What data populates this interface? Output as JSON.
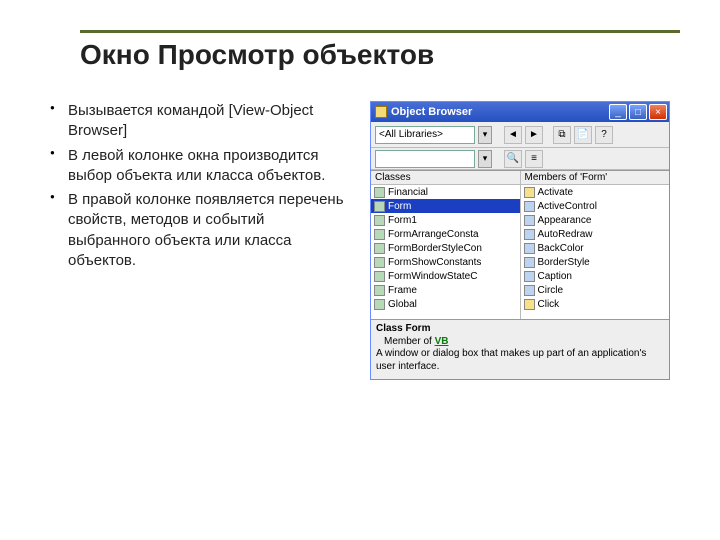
{
  "title": "Окно Просмотр объектов",
  "bullets": [
    "Вызывается командой [View-Object Browser]",
    "В левой колонке окна производится выбор объекта или класса объектов.",
    "В правой колонке появляется перечень свойств, методов и событий выбранного объекта или класса объектов."
  ],
  "ob": {
    "title": "Object Browser",
    "buttons": {
      "min": "_",
      "max": "□",
      "close": "×"
    },
    "library_combo": "<All Libraries>",
    "nav": {
      "back": "◄",
      "fwd": "►",
      "sep": "|",
      "copy": "⧉",
      "help": "?"
    },
    "search_combo": "",
    "search_btns": {
      "go": "🔍",
      "show": "≡"
    },
    "left": {
      "header": "Classes",
      "items": [
        "Financial",
        "Form",
        "Form1",
        "FormArrangeConsta",
        "FormBorderStyleCon",
        "FormShowConstants",
        "FormWindowStateC",
        "Frame",
        "Global"
      ],
      "selected": 1
    },
    "right": {
      "header": "Members of 'Form'",
      "items": [
        "Activate",
        "ActiveControl",
        "Appearance",
        "AutoRedraw",
        "BackColor",
        "BorderStyle",
        "Caption",
        "Circle",
        "Click"
      ]
    },
    "desc": {
      "classline": "Class Form",
      "member_prefix": "Member of ",
      "member_link": "VB",
      "text": "A window or dialog box that makes up part of an application's user interface."
    }
  }
}
